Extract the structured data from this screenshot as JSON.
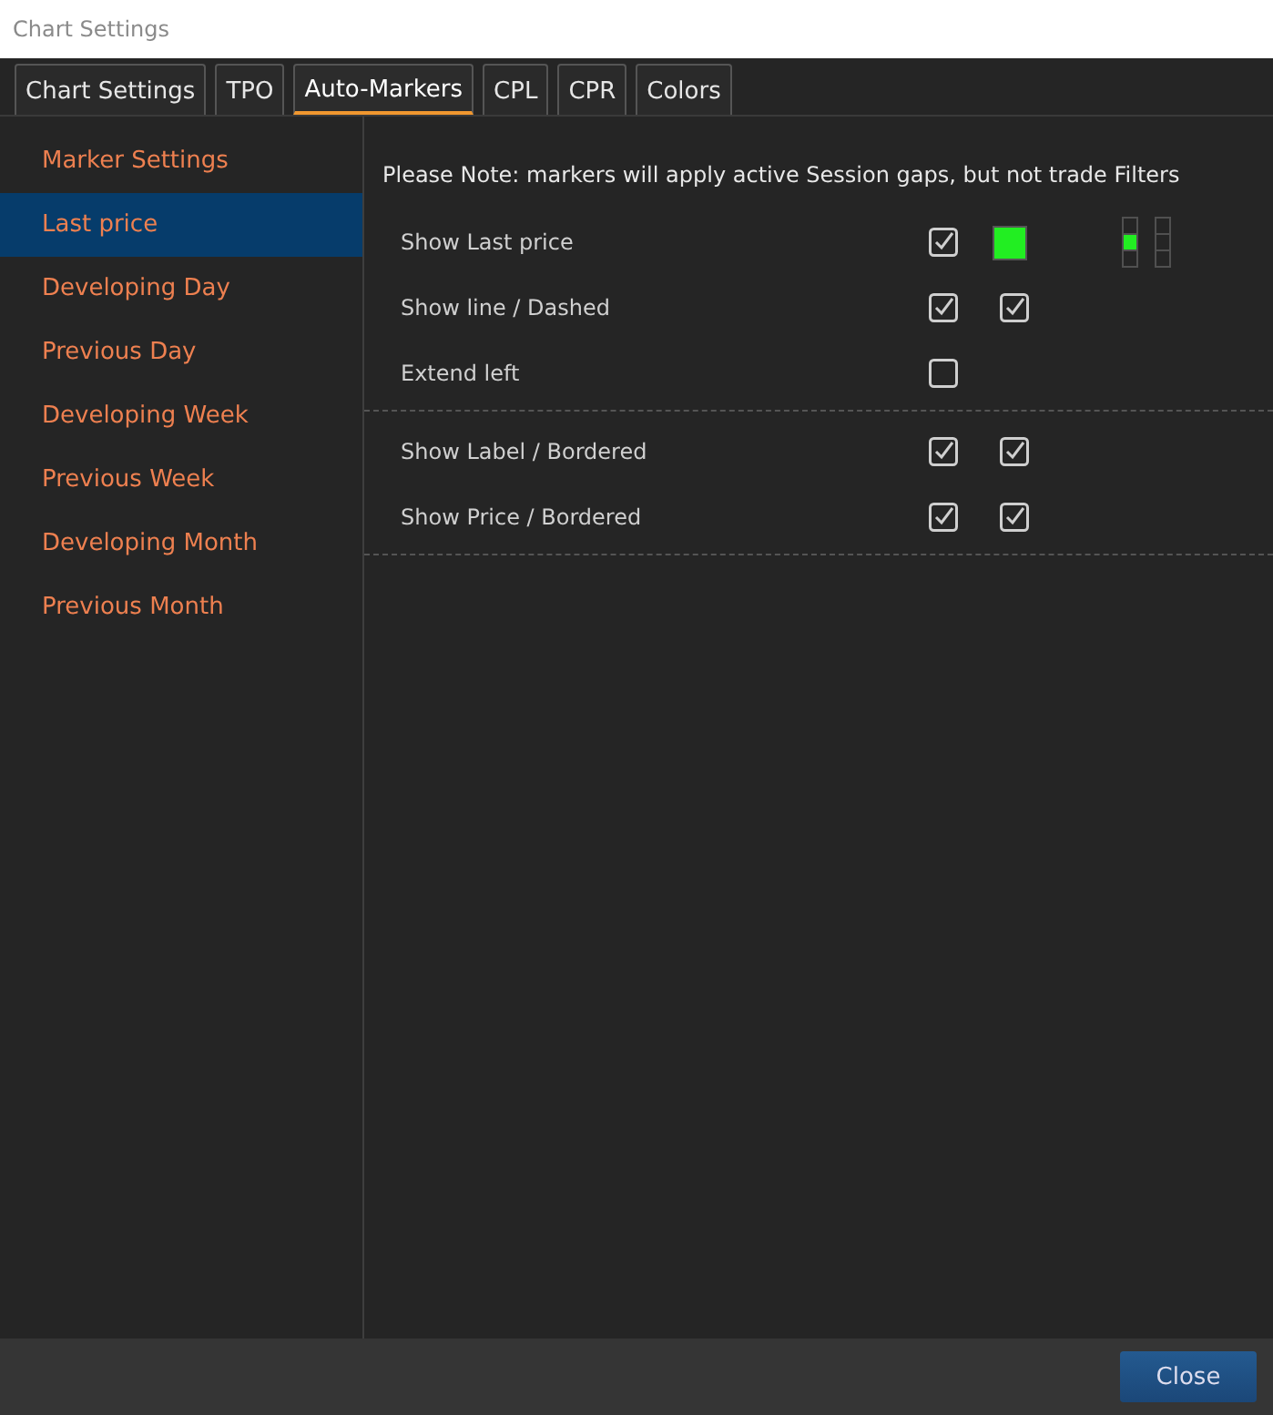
{
  "window": {
    "title": "Chart Settings"
  },
  "tabs": [
    {
      "label": "Chart Settings",
      "selected": false
    },
    {
      "label": "TPO",
      "selected": false
    },
    {
      "label": "Auto-Markers",
      "selected": true
    },
    {
      "label": "CPL",
      "selected": false
    },
    {
      "label": "CPR",
      "selected": false
    },
    {
      "label": "Colors",
      "selected": false
    }
  ],
  "sidebar": {
    "items": [
      {
        "label": "Marker Settings",
        "selected": false
      },
      {
        "label": "Last price",
        "selected": true
      },
      {
        "label": "Developing Day",
        "selected": false
      },
      {
        "label": "Previous Day",
        "selected": false
      },
      {
        "label": "Developing Week",
        "selected": false
      },
      {
        "label": "Previous Week",
        "selected": false
      },
      {
        "label": "Developing Month",
        "selected": false
      },
      {
        "label": "Previous Month",
        "selected": false
      }
    ]
  },
  "note": "Please Note: markers will apply active Session gaps, but not trade Filters",
  "sections": [
    {
      "rows": [
        {
          "label": "Show Last price",
          "controls": [
            {
              "kind": "checkbox",
              "checked": true
            },
            {
              "kind": "swatch",
              "color": "#22ee22"
            }
          ],
          "pickers": [
            {
              "cells": [
                {
                  "selected": false
                },
                {
                  "selected": true
                },
                {
                  "selected": false
                }
              ]
            },
            {
              "cells": [
                {
                  "selected": false
                },
                {
                  "selected": false
                },
                {
                  "selected": false
                }
              ]
            }
          ]
        },
        {
          "label": "Show line / Dashed",
          "controls": [
            {
              "kind": "checkbox",
              "checked": true
            },
            {
              "kind": "checkbox",
              "checked": true
            }
          ]
        },
        {
          "label": "Extend left",
          "controls": [
            {
              "kind": "checkbox",
              "checked": false
            }
          ]
        }
      ]
    },
    {
      "rows": [
        {
          "label": "Show Label / Bordered",
          "controls": [
            {
              "kind": "checkbox",
              "checked": true
            },
            {
              "kind": "checkbox",
              "checked": true
            }
          ]
        },
        {
          "label": "Show Price / Bordered",
          "controls": [
            {
              "kind": "checkbox",
              "checked": true
            },
            {
              "kind": "checkbox",
              "checked": true
            }
          ]
        }
      ]
    }
  ],
  "buttons": [
    {
      "label": "Close"
    }
  ]
}
